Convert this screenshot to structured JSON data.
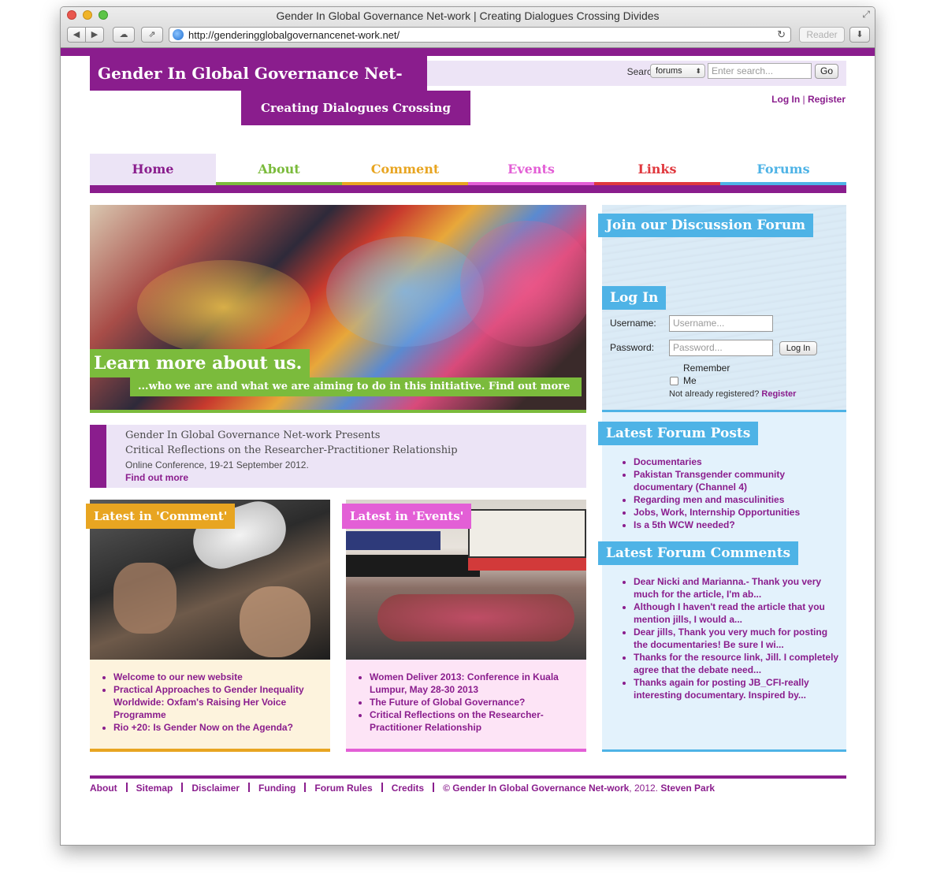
{
  "browser": {
    "window_title": "Gender In Global Governance Net-work | Creating Dialogues Crossing Divides",
    "url": "http://genderingglobalgovernancenet-work.net/",
    "reader_label": "Reader"
  },
  "header": {
    "site_title": "Gender In Global Governance Net-work",
    "tagline": "Creating Dialogues Crossing Divides",
    "search_label": "Search the:",
    "search_scope": "forums",
    "search_placeholder": "Enter search...",
    "search_button": "Go",
    "login_link": "Log In",
    "register_link": "Register"
  },
  "nav": {
    "items": [
      {
        "label": "Home",
        "color": "#8a1d8d"
      },
      {
        "label": "About",
        "color": "#7bbb3c"
      },
      {
        "label": "Comment",
        "color": "#e8a521"
      },
      {
        "label": "Events",
        "color": "#e35fd6"
      },
      {
        "label": "Links",
        "color": "#e0383e"
      },
      {
        "label": "Forums",
        "color": "#4eb3e6"
      }
    ]
  },
  "hero": {
    "title": "Learn more about us.",
    "subtitle": "...who we are and what we are aiming to do in this initiative. Find out more"
  },
  "conference": {
    "line1": "Gender In Global Governance Net-work Presents",
    "line2": "Critical Reflections on the Researcher-Practitioner Relationship",
    "line3": "Online Conference, 19-21 September 2012.",
    "link": "Find out more"
  },
  "comment": {
    "heading": "Latest in 'Comment'",
    "items": [
      "Welcome to our new website",
      "Practical Approaches to Gender Inequality Worldwide: Oxfam's Raising Her Voice Programme",
      "Rio +20: Is Gender Now on the Agenda?"
    ]
  },
  "events": {
    "heading": "Latest in 'Events'",
    "items": [
      "Women Deliver 2013: Conference in Kuala Lumpur, May 28-30 2013",
      "The Future of Global Governance?",
      "Critical Reflections on the Researcher-Practitioner Relationship"
    ]
  },
  "sidebar": {
    "join_heading": "Join our Discussion Forum",
    "login_heading": "Log In",
    "username_label": "Username:",
    "username_placeholder": "Username...",
    "password_label": "Password:",
    "password_placeholder": "Password...",
    "login_button": "Log In",
    "remember_label": "Remember",
    "me_label": "Me",
    "not_registered": "Not already registered?",
    "register_link": "Register",
    "posts_heading": "Latest Forum Posts",
    "posts": [
      "Documentaries",
      "Pakistan Transgender community documentary (Channel 4)",
      "Regarding men and masculinities",
      "Jobs, Work, Internship Opportunities",
      "Is a 5th WCW needed?"
    ],
    "comments_heading": "Latest Forum Comments",
    "comments": [
      "Dear Nicki and Marianna.- Thank you very much for the article, I'm ab...",
      "Although I haven't read the article that you mention jills, I would a...",
      "Dear jills, Thank you very much for posting the documentaries! Be sure I wi...",
      "Thanks for the resource link, Jill. I completely agree that the debate need...",
      "Thanks again for posting JB_CFI-really interesting documentary. Inspired by..."
    ]
  },
  "footer": {
    "links": [
      "About",
      "Sitemap",
      "Disclaimer",
      "Funding",
      "Forum Rules",
      "Credits"
    ],
    "copyright_prefix": "© Gender In Global Governance Net-work",
    "copyright_year": ", 2012.",
    "author": "Steven Park"
  }
}
